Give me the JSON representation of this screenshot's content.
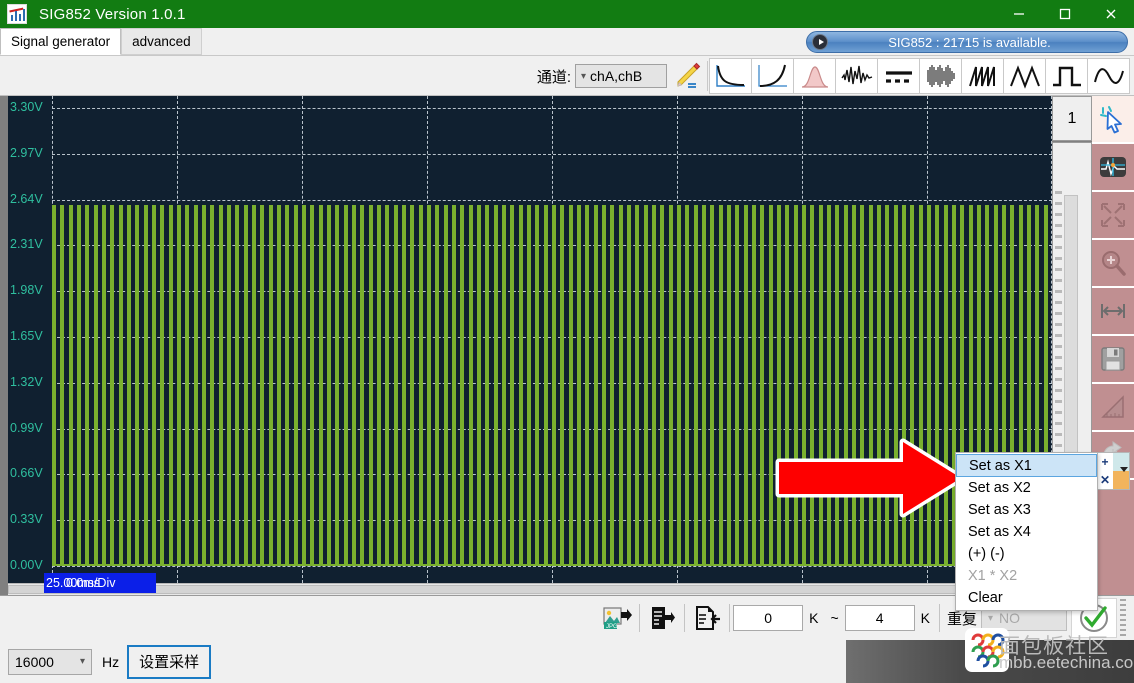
{
  "window": {
    "title": "SIG852  Version 1.0.1",
    "app_icon": "chart-app-icon",
    "minimize": "minimize-icon",
    "maximize": "maximize-icon",
    "close": "close-icon",
    "titlebar_color": "#127c12"
  },
  "tabs": [
    {
      "label": "Signal generator",
      "active": true
    },
    {
      "label": "advanced",
      "active": false
    }
  ],
  "notification": {
    "text": "SIG852 : 21715 is available.",
    "icon": "play-icon"
  },
  "toolbar": {
    "channel_label": "通道:",
    "channel_value": "chA,chB",
    "edit_icon": "pencil-edit-icon",
    "waveforms": [
      "exp-decay-icon",
      "exp-rise-icon",
      "gaussian-icon",
      "noise-burst-icon",
      "dashed-dc-icon",
      "am-modulated-icon",
      "sawtooth-icon",
      "triangle-icon",
      "square-icon",
      "sine-icon"
    ]
  },
  "chart_data": {
    "type": "line",
    "title": "",
    "xlabel": "25.00ms/Div",
    "ylabel": "",
    "ylim": [
      0.0,
      3.3
    ],
    "ytick_labels": [
      "3.30V",
      "2.97V",
      "2.64V",
      "2.31V",
      "1.98V",
      "1.65V",
      "1.32V",
      "0.99V",
      "0.66V",
      "0.33V",
      "0.00V"
    ],
    "ytick_values": [
      3.3,
      2.97,
      2.64,
      2.31,
      1.98,
      1.65,
      1.32,
      0.99,
      0.66,
      0.33,
      0.0
    ],
    "x_div_count": 8,
    "y_gridline_count": 10,
    "grid": true,
    "series": [
      {
        "name": "chA",
        "color": "#7ab02e",
        "waveform": "square",
        "high_level": 2.6,
        "low_level": 0.0,
        "duty_cycle": 50,
        "pulse_count": 120
      }
    ],
    "background": "#102030",
    "gridline_color": "#b9c3cc"
  },
  "plot": {
    "time_per_div": "25.00ms/Div",
    "cursor_time": "0.0ms",
    "index_label": "1"
  },
  "context_menu": {
    "items": [
      {
        "label": "Set as X1",
        "selected": true,
        "disabled": false
      },
      {
        "label": "Set as X2",
        "selected": false,
        "disabled": false
      },
      {
        "label": "Set as X3",
        "selected": false,
        "disabled": false
      },
      {
        "label": "Set as X4",
        "selected": false,
        "disabled": false
      },
      {
        "label": "(+)  (-)",
        "selected": false,
        "disabled": false
      },
      {
        "label": "X1 * X2",
        "selected": false,
        "disabled": true
      },
      {
        "label": "Clear",
        "selected": false,
        "disabled": false
      }
    ]
  },
  "rail": {
    "items": [
      "cursor-select-icon",
      "waveform-view-icon",
      "expand-arrows-icon",
      "zoom-in-icon",
      "horizontal-measure-icon",
      "save-disk-icon",
      "ruler-triangle-icon",
      "refresh-icon"
    ]
  },
  "mini_popup": {
    "add_icon": "plus-icon",
    "remove_icon": "close-x-icon",
    "caret": "chevron-down-icon"
  },
  "bottom_bar": {
    "export_jpg_icon": "export-jpg-icon",
    "export_file_icon": "export-file-icon",
    "import_file_icon": "import-file-icon",
    "range_start": "0",
    "range_start_unit": "K",
    "range_separator": "~",
    "range_end": "4",
    "range_end_unit": "K",
    "repeat_label": "重复",
    "repeat_value": "NO",
    "confirm_icon": "check-circle-icon"
  },
  "footer": {
    "sample_rate": "16000",
    "sample_rate_unit": "Hz",
    "sample_button": "设置采样",
    "caret": "chevron-down-icon"
  },
  "watermark": {
    "cn_text": "面包板社区",
    "en_text": "mbb.eetechina.com"
  },
  "annotation": {
    "arrow": "red-right-arrow"
  }
}
